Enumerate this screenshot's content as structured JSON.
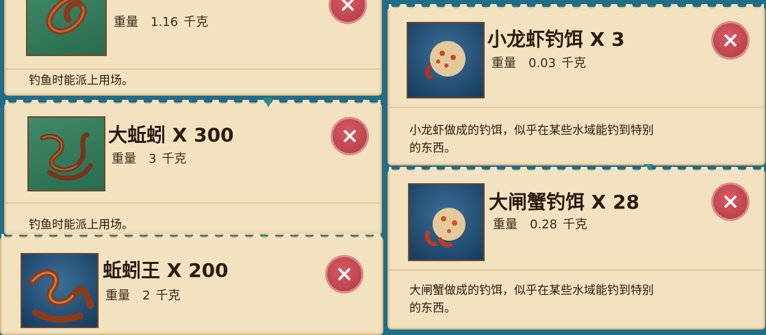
{
  "items": [
    {
      "id": "item-top-left",
      "name": "",
      "weight_label": "重量",
      "weight_value": "1.16",
      "weight_unit": "千克",
      "description": "钓鱼时能派上用场。",
      "icon": "worm-icon",
      "bg": "green"
    },
    {
      "id": "item-big-earthworm",
      "name": "大蚯蚓 X 300",
      "weight_label": "重量",
      "weight_value": "3",
      "weight_unit": "千克",
      "description": "钓鱼时能派上用场。",
      "icon": "earthworm-icon",
      "bg": "green"
    },
    {
      "id": "item-earthworm-king",
      "name": "蚯蚓王 X 200",
      "weight_label": "重量",
      "weight_value": "2",
      "weight_unit": "千克",
      "description": "",
      "icon": "earthworm-king-icon",
      "bg": "blue"
    },
    {
      "id": "item-crayfish-bait",
      "name": "小龙虾钓饵 X 3",
      "weight_label": "重量",
      "weight_value": "0.03",
      "weight_unit": "千克",
      "description_line1": "小龙虾做成的钓饵，似乎在某些水域能钓到特别",
      "description_line2": "的东西。",
      "icon": "crayfish-bait-icon",
      "bg": "blue"
    },
    {
      "id": "item-crab-bait",
      "name": "大闸蟹钓饵 X 28",
      "weight_label": "重量",
      "weight_value": "0.28",
      "weight_unit": "千克",
      "description_line1": "大闸蟹做成的钓饵，似乎在某些水域能钓到特别",
      "description_line2": "的东西。",
      "icon": "crab-bait-icon",
      "bg": "blue"
    }
  ],
  "colors": {
    "parchment": "#f3e2c0",
    "discard_red": "#c9474f",
    "background": "#1f6d86"
  },
  "discard_icon": "discard-x-icon"
}
